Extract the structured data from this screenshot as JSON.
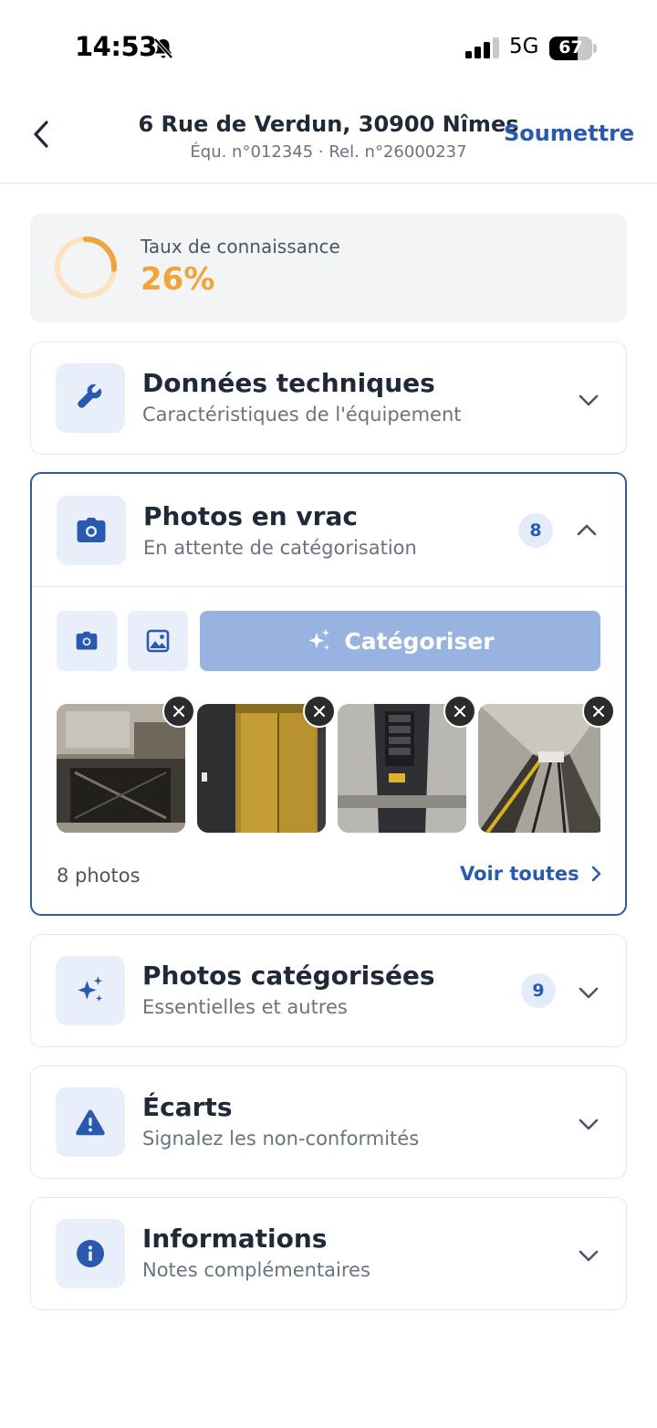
{
  "status_bar": {
    "time": "14:53",
    "network": "5G",
    "battery": "67",
    "battery_level": 0.67
  },
  "header": {
    "title": "6 Rue de Verdun, 30900 Nîmes",
    "subtitle": "Équ. n°012345 · Rel. n°26000237",
    "submit_label": "Soumettre"
  },
  "knowledge": {
    "label": "Taux de connaissance",
    "value": "26%",
    "progress": 0.26,
    "color": "#f0a43a"
  },
  "sections": {
    "technical": {
      "title": "Données techniques",
      "subtitle": "Caractéristiques de l'équipement",
      "icon": "wrench-icon"
    },
    "loose_photos": {
      "title": "Photos en vrac",
      "subtitle": "En attente de catégorisation",
      "count": "8",
      "icon": "camera-icon",
      "categorize_label": "Catégoriser",
      "photo_count_label": "8 photos",
      "see_all_label": "Voir toutes"
    },
    "categorized_photos": {
      "title": "Photos catégorisées",
      "subtitle": "Essentielles et autres",
      "count": "9",
      "icon": "sparkles-icon"
    },
    "deviations": {
      "title": "Écarts",
      "subtitle": "Signalez les non-conformités",
      "icon": "warning-icon"
    },
    "information": {
      "title": "Informations",
      "subtitle": "Notes complémentaires",
      "icon": "info-icon"
    }
  },
  "colors": {
    "accent": "#2a5ab0",
    "tile_bg": "#e8effa",
    "progress": "#f0a43a",
    "categorize_bg": "#98b3e0"
  }
}
